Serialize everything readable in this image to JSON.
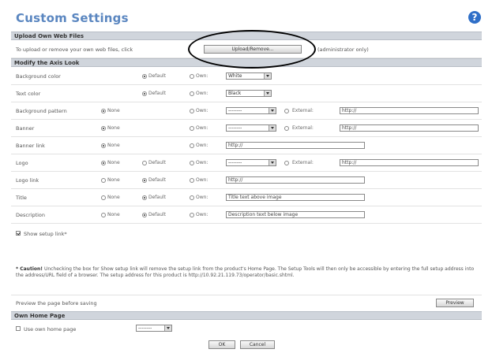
{
  "page": {
    "title": "Custom Settings",
    "help_icon": "?"
  },
  "upload": {
    "header": "Upload Own Web Files",
    "text_before": "To upload or remove your own web files, click",
    "button": "Upload/Remove...",
    "text_after": "(administrator only)"
  },
  "look": {
    "header": "Modify the Axis Look",
    "labels": {
      "none": "None",
      "default": "Default",
      "own": "Own:",
      "external": "External:"
    },
    "rows": [
      {
        "label": "Background color",
        "own_value": "White"
      },
      {
        "label": "Text color",
        "own_value": "Black"
      },
      {
        "label": "Background pattern",
        "own_value": "--------",
        "external_value": "http://"
      },
      {
        "label": "Banner",
        "own_value": "--------",
        "external_value": "http://"
      },
      {
        "label": "Banner link",
        "own_value": "http://"
      },
      {
        "label": "Logo",
        "own_value": "--------",
        "external_value": "http://"
      },
      {
        "label": "Logo link",
        "own_value": "http://"
      },
      {
        "label": "Title",
        "own_value": "Title text above image"
      },
      {
        "label": "Description",
        "own_value": "Description text below image"
      }
    ],
    "show_setup": "Show setup link*"
  },
  "caution": {
    "prefix": "* Caution!",
    "text": "Unchecking the box for Show setup link will remove the setup link from the product's Home Page. The Setup Tools will then only be accessible by entering the full setup address into the address/URL field of a browser. The setup address for this product is http://10.92.21.119.73/operator/basic.shtml."
  },
  "preview": {
    "text": "Preview the page before saving",
    "button": "Preview"
  },
  "home": {
    "header": "Own Home Page",
    "checkbox": "Use own home page",
    "select": "--------",
    "ok": "OK",
    "cancel": "Cancel"
  },
  "colors": {
    "title": "#5a86c0",
    "band": "#d0d5dc",
    "help": "#2f6fc8"
  }
}
